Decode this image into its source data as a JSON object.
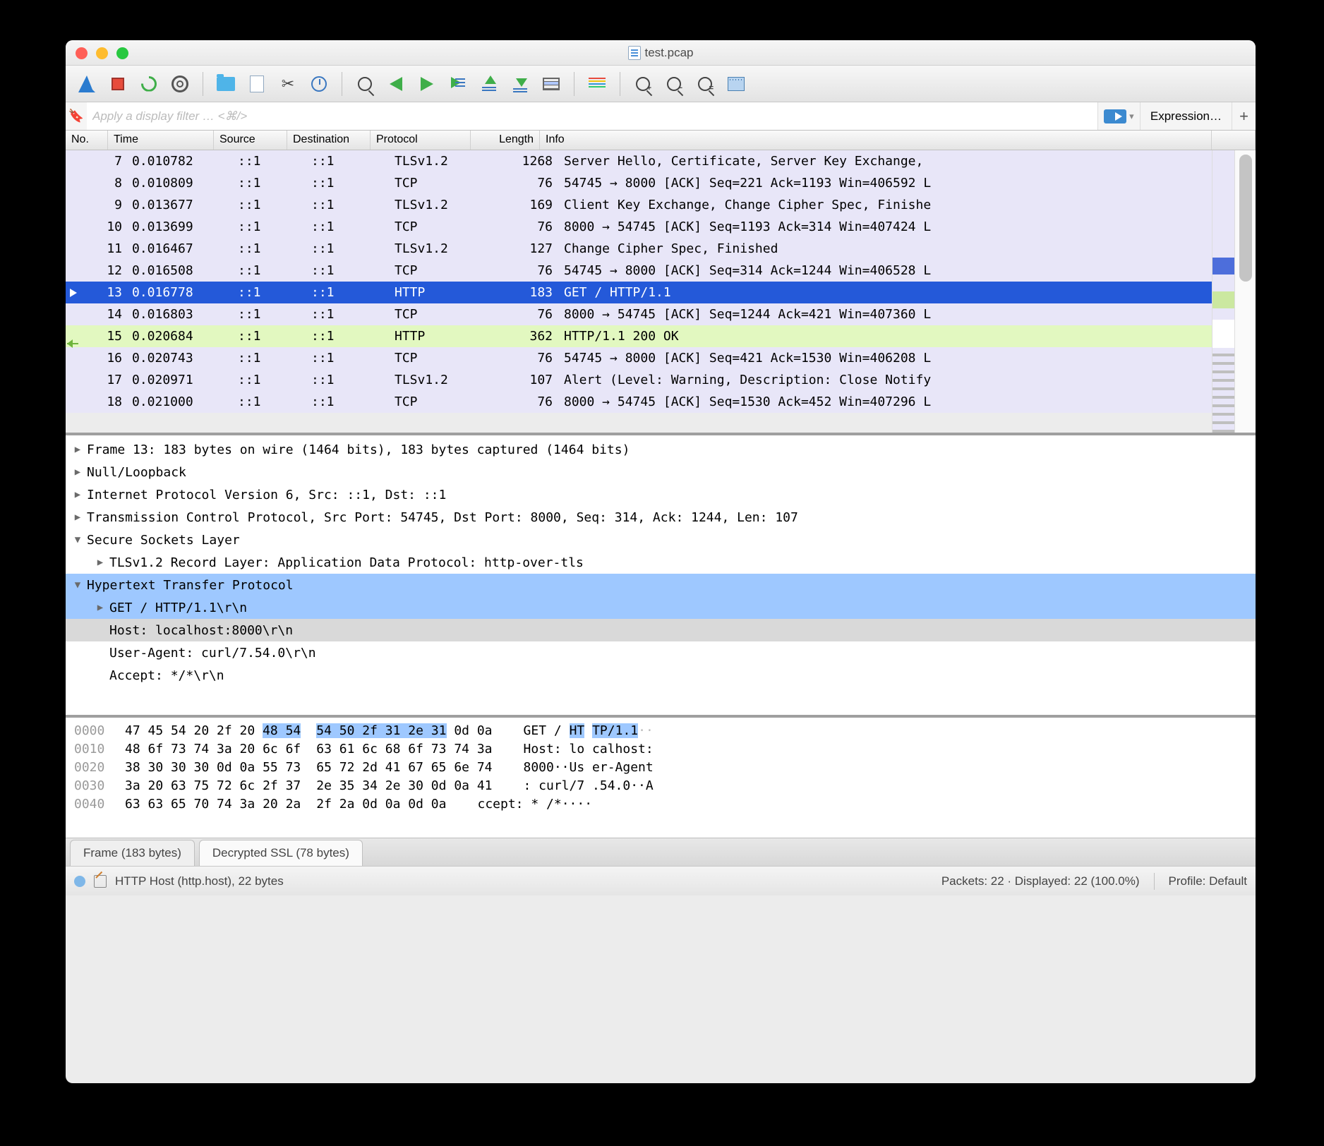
{
  "title": "test.pcap",
  "filter_placeholder": "Apply a display filter … <⌘/>",
  "expression_label": "Expression…",
  "columns": {
    "no": "No.",
    "time": "Time",
    "source": "Source",
    "dest": "Destination",
    "proto": "Protocol",
    "len": "Length",
    "info": "Info"
  },
  "packets": [
    {
      "no": 7,
      "time": "0.010782",
      "src": "::1",
      "dst": "::1",
      "proto": "TLSv1.2",
      "len": 1268,
      "info": "Server Hello, Certificate, Server Key Exchange,",
      "bg": "lav"
    },
    {
      "no": 8,
      "time": "0.010809",
      "src": "::1",
      "dst": "::1",
      "proto": "TCP",
      "len": 76,
      "info": "54745 → 8000 [ACK] Seq=221 Ack=1193 Win=406592 L",
      "bg": "lav"
    },
    {
      "no": 9,
      "time": "0.013677",
      "src": "::1",
      "dst": "::1",
      "proto": "TLSv1.2",
      "len": 169,
      "info": "Client Key Exchange, Change Cipher Spec, Finishe",
      "bg": "lav"
    },
    {
      "no": 10,
      "time": "0.013699",
      "src": "::1",
      "dst": "::1",
      "proto": "TCP",
      "len": 76,
      "info": "8000 → 54745 [ACK] Seq=1193 Ack=314 Win=407424 L",
      "bg": "lav"
    },
    {
      "no": 11,
      "time": "0.016467",
      "src": "::1",
      "dst": "::1",
      "proto": "TLSv1.2",
      "len": 127,
      "info": "Change Cipher Spec, Finished",
      "bg": "lav"
    },
    {
      "no": 12,
      "time": "0.016508",
      "src": "::1",
      "dst": "::1",
      "proto": "TCP",
      "len": 76,
      "info": "54745 → 8000 [ACK] Seq=314 Ack=1244 Win=406528 L",
      "bg": "lav"
    },
    {
      "no": 13,
      "time": "0.016778",
      "src": "::1",
      "dst": "::1",
      "proto": "HTTP",
      "len": 183,
      "info": "GET / HTTP/1.1",
      "bg": "sel",
      "mark": "sel"
    },
    {
      "no": 14,
      "time": "0.016803",
      "src": "::1",
      "dst": "::1",
      "proto": "TCP",
      "len": 76,
      "info": "8000 → 54745 [ACK] Seq=1244 Ack=421 Win=407360 L",
      "bg": "lav"
    },
    {
      "no": 15,
      "time": "0.020684",
      "src": "::1",
      "dst": "::1",
      "proto": "HTTP",
      "len": 362,
      "info": "HTTP/1.1 200 OK",
      "bg": "grn",
      "mark": "grn"
    },
    {
      "no": 16,
      "time": "0.020743",
      "src": "::1",
      "dst": "::1",
      "proto": "TCP",
      "len": 76,
      "info": "54745 → 8000 [ACK] Seq=421 Ack=1530 Win=406208 L",
      "bg": "lav"
    },
    {
      "no": 17,
      "time": "0.020971",
      "src": "::1",
      "dst": "::1",
      "proto": "TLSv1.2",
      "len": 107,
      "info": "Alert (Level: Warning, Description: Close Notify",
      "bg": "lav"
    },
    {
      "no": 18,
      "time": "0.021000",
      "src": "::1",
      "dst": "::1",
      "proto": "TCP",
      "len": 76,
      "info": "8000 → 54745 [ACK] Seq=1530 Ack=452 Win=407296 L",
      "bg": "lav"
    }
  ],
  "tree": [
    {
      "text": "Frame 13: 183 bytes on wire (1464 bits), 183 bytes captured (1464 bits)",
      "exp": "closed",
      "lvl": 0
    },
    {
      "text": "Null/Loopback",
      "exp": "closed",
      "lvl": 0
    },
    {
      "text": "Internet Protocol Version 6, Src: ::1, Dst: ::1",
      "exp": "closed",
      "lvl": 0
    },
    {
      "text": "Transmission Control Protocol, Src Port: 54745, Dst Port: 8000, Seq: 314, Ack: 1244, Len: 107",
      "exp": "closed",
      "lvl": 0
    },
    {
      "text": "Secure Sockets Layer",
      "exp": "open",
      "lvl": 0
    },
    {
      "text": "TLSv1.2 Record Layer: Application Data Protocol: http-over-tls",
      "exp": "closed",
      "lvl": 1
    },
    {
      "text": "Hypertext Transfer Protocol",
      "exp": "open",
      "lvl": 0,
      "sel": true
    },
    {
      "text": "GET / HTTP/1.1\\r\\n",
      "exp": "closed",
      "lvl": 1,
      "sel": true
    },
    {
      "text": "Host: localhost:8000\\r\\n",
      "exp": "none",
      "lvl": 1,
      "grey": true
    },
    {
      "text": "User-Agent: curl/7.54.0\\r\\n",
      "exp": "none",
      "lvl": 1
    },
    {
      "text": "Accept: */*\\r\\n",
      "exp": "none",
      "lvl": 1
    }
  ],
  "hex": [
    {
      "addr": "0000",
      "b1": "47 45 54 20 2f 20 ",
      "b1h": "48 54",
      "b2h": "54 50 2f 31 2e 31",
      "b2": " 0d 0a",
      "a1": "GET / ",
      "a1h": "HT",
      "a2h": "TP/1.1",
      "a2": "··"
    },
    {
      "addr": "0010",
      "b1": "48 6f 73 74 3a 20 6c 6f",
      "b2": "63 61 6c 68 6f 73 74 3a",
      "a1": "Host: lo",
      "a2": "calhost:"
    },
    {
      "addr": "0020",
      "b1": "38 30 30 30 0d 0a 55 73",
      "b2": "65 72 2d 41 67 65 6e 74",
      "a1": "8000··Us",
      "a2": "er-Agent"
    },
    {
      "addr": "0030",
      "b1": "3a 20 63 75 72 6c 2f 37",
      "b2": "2e 35 34 2e 30 0d 0a 41",
      "a1": ": curl/7",
      "a2": ".54.0··A"
    },
    {
      "addr": "0040",
      "b1": "63 63 65 70 74 3a 20 2a",
      "b2": "2f 2a 0d 0a 0d 0a",
      "a1": "ccept: *",
      "a2": "/*····"
    }
  ],
  "byte_tabs": {
    "frame": "Frame (183 bytes)",
    "ssl": "Decrypted SSL (78 bytes)"
  },
  "status": {
    "field": "HTTP Host (http.host), 22 bytes",
    "packets": "Packets: 22 · Displayed: 22 (100.0%)",
    "profile": "Profile: Default"
  }
}
